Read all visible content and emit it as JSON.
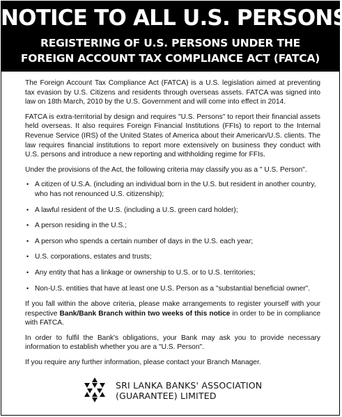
{
  "header": {
    "title": "NOTICE TO ALL U.S. PERSONS",
    "subtitle_line1": "REGISTERING OF U.S. PERSONS UNDER THE",
    "subtitle_line2": "FOREIGN ACCOUNT TAX COMPLIANCE ACT (FATCA)"
  },
  "body": {
    "para1": "The Foreign Account Tax Compliance Act (FATCA) is a U.S. legislation aimed at preventing tax evasion by U.S. Citizens and residents through overseas assets. FATCA was signed into law on 18th March, 2010 by the U.S. Government and will come into effect in 2014.",
    "para2": "FATCA is extra-territorial by design and requires \"U.S. Persons\" to report their financial assets held overseas. It also requires Foreign Financial Institutions (FFIs) to report to the Internal Revenue Service (IRS) of the United States of America about their American/U.S. clients. The law requires financial institutions to report more extensively on business they conduct with U.S. persons and introduce a new reporting and withholding regime for FFIs.",
    "para3": "Under the provisions of the Act, the following criteria may classify you as a \" U.S. Person\".",
    "bullet_symbol": "•",
    "criteria": [
      "A citizen of U.S.A. (including an individual born in the U.S. but resident in another country, who has not renounced U.S. citizenship);",
      "A lawful resident of the U.S. (including a U.S. green card holder);",
      "A person residing in the U.S.;",
      "A person who spends a certain number of days in the U.S. each year;",
      "U.S. corporations, estates and trusts;",
      "Any entity that has a linkage or ownership to U.S. or to U.S. territories;",
      "Non-U.S. entities that have at least one U.S. Person as a \"substantial beneficial owner\"."
    ],
    "para4_start": "If you fall within the above criteria, please make arrangements to register yourself with your respective ",
    "para4_bold": "Bank/Bank Branch within two weeks of this notice",
    "para4_end": " in order to be in compliance with FATCA.",
    "para5": "In order to fulfil the Bank's obligations, your Bank may ask you to provide necessary information to establish whether you are a \"U.S. Person\".",
    "para6": "If you require any further information, please contact your Branch Manager."
  },
  "footer": {
    "logo_icon": "star-of-david-triangles-logo",
    "association_line1": "SRI LANKA BANKS' ASSOCIATION",
    "association_line2": "(GUARANTEE) LIMITED"
  }
}
